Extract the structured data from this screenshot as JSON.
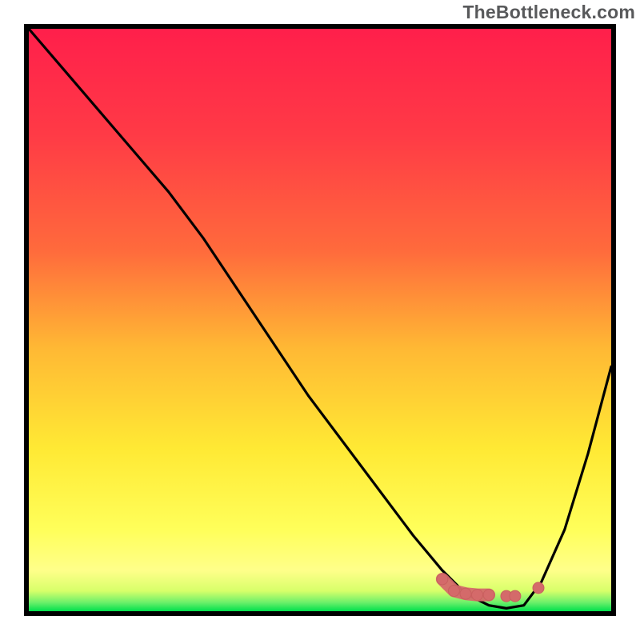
{
  "watermark": "TheBottleneck.com",
  "colors": {
    "gradient_top": "#ff1f4b",
    "gradient_mid1": "#ff6a3c",
    "gradient_mid2": "#ffb934",
    "gradient_mid3": "#ffe934",
    "gradient_low_yellow": "#ffff8a",
    "gradient_bottom": "#00e04c",
    "curve": "#000000",
    "marker_fill": "#d46a6a",
    "marker_stroke": "#c95f5f",
    "border": "#000000"
  },
  "chart_data": {
    "type": "line",
    "title": "",
    "xlabel": "",
    "ylabel": "",
    "xlim": [
      0,
      100
    ],
    "ylim": [
      0,
      100
    ],
    "grid": false,
    "legend": false,
    "series": [
      {
        "name": "bottleneck-curve",
        "x": [
          0,
          6,
          12,
          18,
          24,
          30,
          36,
          42,
          48,
          54,
          60,
          66,
          71,
          75,
          79,
          82,
          85,
          88,
          92,
          96,
          100
        ],
        "y": [
          100,
          93,
          86,
          79,
          72,
          64,
          55,
          46,
          37,
          29,
          21,
          13,
          7,
          3,
          1,
          0.5,
          1,
          5,
          14,
          27,
          42
        ]
      }
    ],
    "markers": [
      {
        "name": "marker-cluster-start",
        "x": 71,
        "y": 5.5
      },
      {
        "name": "marker-cluster-a",
        "x": 73,
        "y": 3.5
      },
      {
        "name": "marker-cluster-b",
        "x": 75,
        "y": 3.0
      },
      {
        "name": "marker-cluster-c",
        "x": 77,
        "y": 2.8
      },
      {
        "name": "marker-cluster-d",
        "x": 79,
        "y": 2.8
      },
      {
        "name": "marker-isolated-1",
        "x": 82,
        "y": 2.6
      },
      {
        "name": "marker-isolated-2",
        "x": 83.5,
        "y": 2.6
      },
      {
        "name": "marker-isolated-3",
        "x": 87.5,
        "y": 4.0
      }
    ]
  }
}
